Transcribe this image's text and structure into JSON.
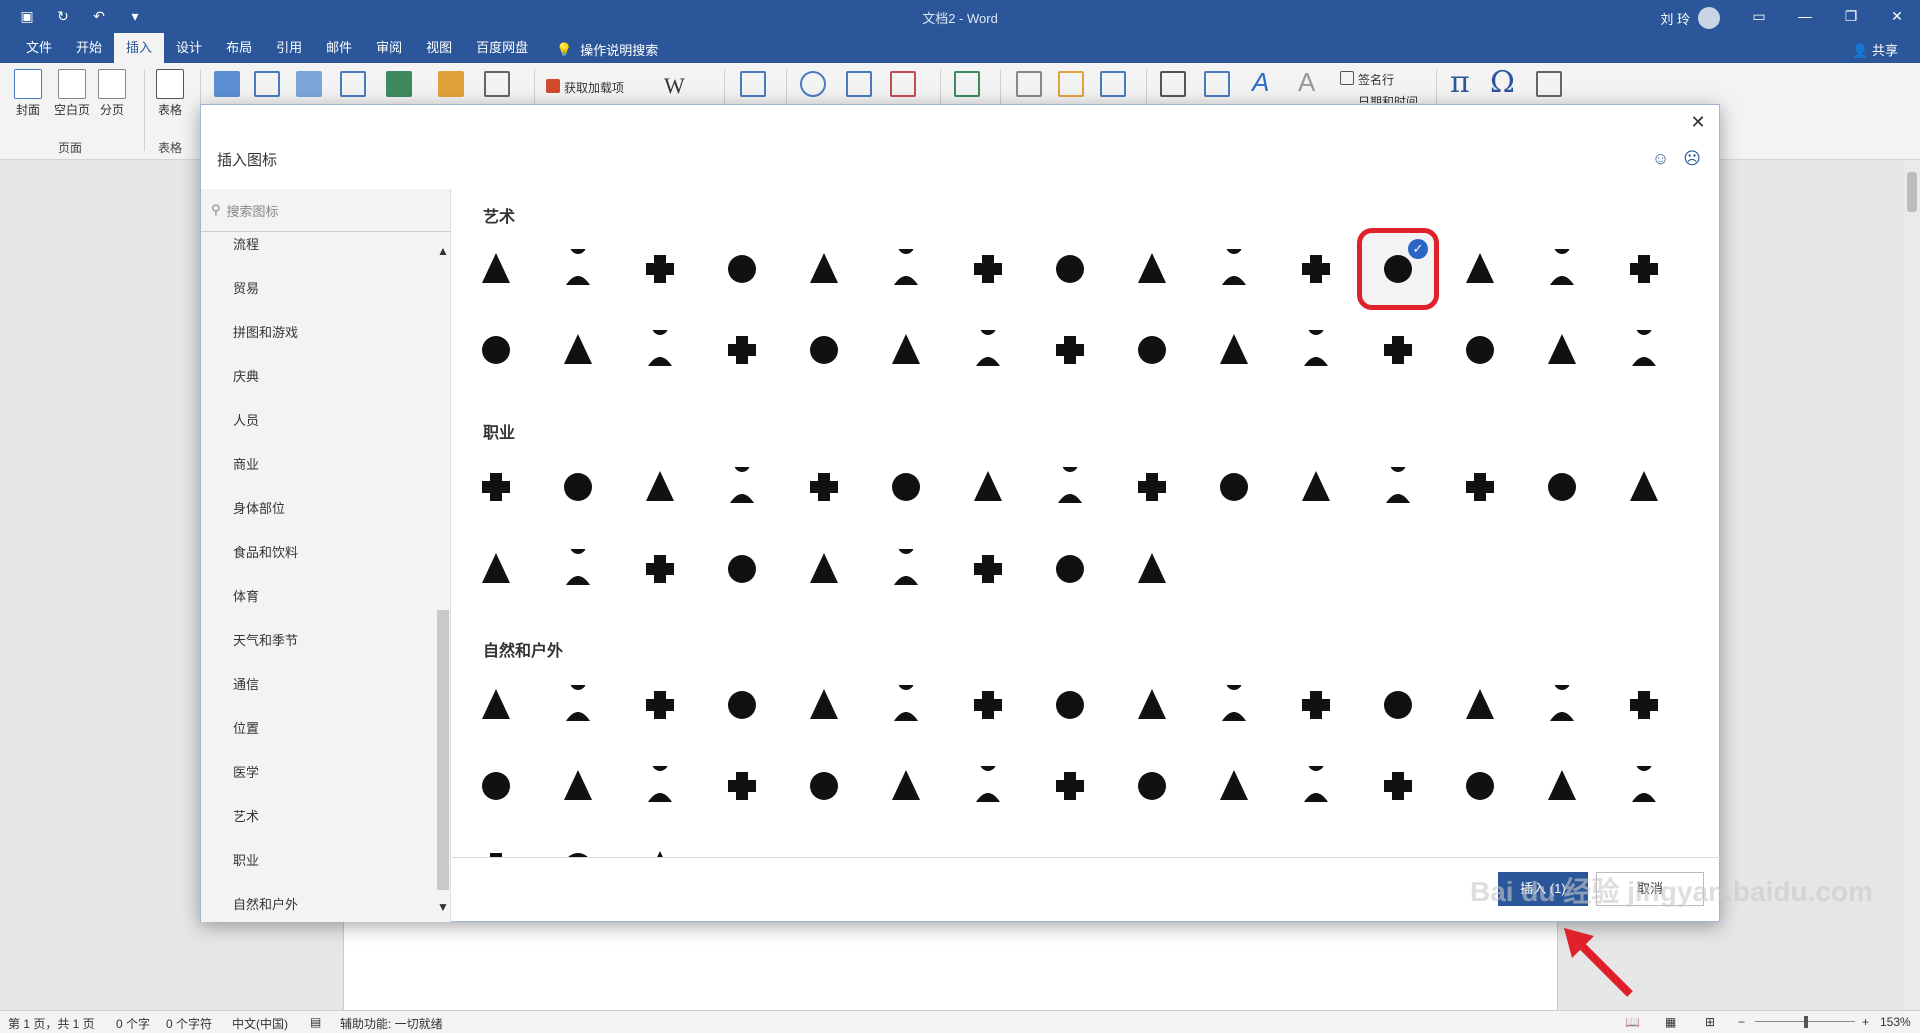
{
  "window": {
    "title": "文档2 - Word",
    "user": "刘 玲",
    "share": "共享",
    "tell_me": "操作说明搜索"
  },
  "ribbon_tabs": [
    "文件",
    "开始",
    "插入",
    "设计",
    "布局",
    "引用",
    "邮件",
    "审阅",
    "视图",
    "百度网盘"
  ],
  "ribbon": {
    "cover": "封面",
    "blank": "空白页",
    "break": "分页",
    "pages_group": "页面",
    "table": "表格",
    "tables_group": "表格",
    "addins": "获取加载项",
    "signature": "签名行",
    "datetime": "日期和时间"
  },
  "dialog": {
    "title": "插入图标",
    "search_placeholder": "搜索图标",
    "categories": [
      "流程",
      "贸易",
      "拼图和游戏",
      "庆典",
      "人员",
      "商业",
      "身体部位",
      "食品和饮料",
      "体育",
      "天气和季节",
      "通信",
      "位置",
      "医学",
      "艺术",
      "职业",
      "自然和户外"
    ],
    "sections": {
      "art": "艺术",
      "occupation": "职业",
      "nature": "自然和户外"
    },
    "insert_button": "插入 (1)",
    "cancel_button": "取消",
    "selected_icon": "treble-clef-icon"
  },
  "status_bar": {
    "page": "第 1 页，共 1 页",
    "words": "0 个字",
    "chars": "0 个字符",
    "language": "中文(中国)",
    "accessibility": "辅助功能: 一切就绪",
    "zoom": "153%"
  },
  "watermark": "Bai du 经验 jingyan.baidu.com",
  "colors": {
    "brand": "#2b579a",
    "highlight": "#e0202b",
    "check": "#2b66c7"
  }
}
